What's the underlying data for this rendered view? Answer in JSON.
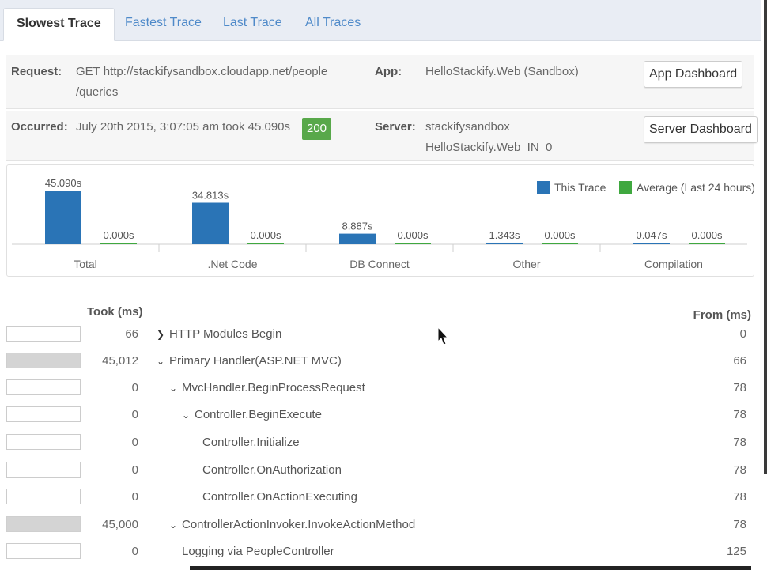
{
  "tabs": [
    {
      "label": "Slowest Trace",
      "active": true
    },
    {
      "label": "Fastest Trace",
      "active": false
    },
    {
      "label": "Last Trace",
      "active": false
    },
    {
      "label": "All Traces",
      "active": false
    }
  ],
  "request": {
    "label": "Request:",
    "value_line1": "GET http://stackifysandbox.cloudapp.net/people",
    "value_line2": "/queries"
  },
  "app": {
    "label": "App:",
    "value": "HelloStackify.Web (Sandbox)",
    "button": "App Dashboard"
  },
  "occurred": {
    "label": "Occurred:",
    "value": "July 20th 2015, 3:07:05 am took 45.090s",
    "status": "200"
  },
  "server": {
    "label": "Server:",
    "value_line1": "stackifysandbox",
    "value_line2": "HelloStackify.Web_IN_0",
    "button": "Server Dashboard"
  },
  "chart_data": {
    "type": "bar",
    "categories": [
      "Total",
      ".Net Code",
      "DB Connect",
      "Other",
      "Compilation"
    ],
    "series": [
      {
        "name": "This Trace",
        "color": "#2a74b6",
        "values": [
          45.09,
          34.813,
          8.887,
          1.343,
          0.047
        ],
        "labels": [
          "45.090s",
          "34.813s",
          "8.887s",
          "1.343s",
          "0.047s"
        ]
      },
      {
        "name": "Average (Last 24 hours)",
        "color": "#3fa83f",
        "values": [
          0.0,
          0.0,
          0.0,
          0.0,
          0.0
        ],
        "labels": [
          "0.000s",
          "0.000s",
          "0.000s",
          "0.000s",
          "0.000s"
        ]
      }
    ],
    "ylim": [
      0,
      45.09
    ],
    "legend": "top-right",
    "grid": false
  },
  "table": {
    "took_header": "Took (ms)",
    "from_header": "From (ms)",
    "rows": [
      {
        "took": "66",
        "name": "HTTP Modules Begin",
        "toggle": "collapsed",
        "from": "0",
        "indent": 0,
        "bar_full": false
      },
      {
        "took": "45,012",
        "name": "Primary Handler(ASP.NET MVC)",
        "toggle": "expanded",
        "from": "66",
        "indent": 0,
        "bar_full": true
      },
      {
        "took": "0",
        "name": "MvcHandler.BeginProcessRequest",
        "toggle": "expanded",
        "from": "78",
        "indent": 1,
        "bar_full": false
      },
      {
        "took": "0",
        "name": "Controller.BeginExecute",
        "toggle": "expanded",
        "from": "78",
        "indent": 2,
        "bar_full": false
      },
      {
        "took": "0",
        "name": "Controller.Initialize",
        "toggle": "none",
        "from": "78",
        "indent": 3,
        "bar_full": false
      },
      {
        "took": "0",
        "name": "Controller.OnAuthorization",
        "toggle": "none",
        "from": "78",
        "indent": 3,
        "bar_full": false
      },
      {
        "took": "0",
        "name": "Controller.OnActionExecuting",
        "toggle": "none",
        "from": "78",
        "indent": 3,
        "bar_full": false
      },
      {
        "took": "45,000",
        "name": "ControllerActionInvoker.InvokeActionMethod",
        "toggle": "expanded",
        "from": "78",
        "indent": 1,
        "bar_full": true
      },
      {
        "took": "0",
        "name": "Logging via PeopleController",
        "toggle": "none",
        "from": "125",
        "indent": 2,
        "bar_full": false
      }
    ]
  },
  "icons": {
    "collapsed": "chevron-right-icon",
    "expanded": "chevron-down-icon",
    "cursor": "mouse-pointer-icon"
  }
}
